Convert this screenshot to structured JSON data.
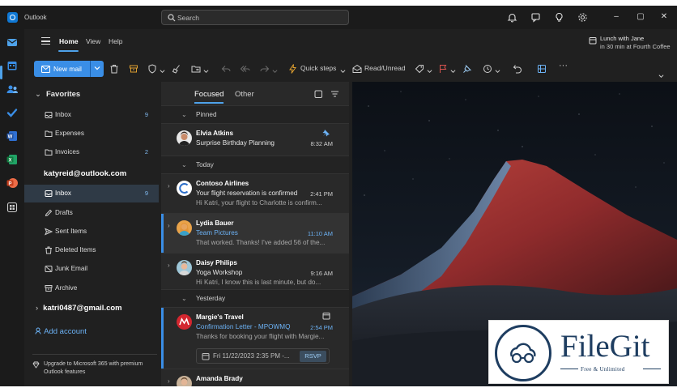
{
  "app": {
    "title": "Outlook"
  },
  "search": {
    "placeholder": "Search"
  },
  "ribbon": {
    "tabs": [
      "Home",
      "View",
      "Help"
    ],
    "reminder": {
      "title": "Lunch with Jane",
      "detail": "in 30 min at Fourth Coffee"
    }
  },
  "toolbar": {
    "new_mail": "New mail",
    "quick_steps": "Quick steps",
    "read_unread": "Read/Unread"
  },
  "folders": {
    "favorites_label": "Favorites",
    "favorites": [
      {
        "name": "Inbox",
        "count": "9"
      },
      {
        "name": "Expenses",
        "count": ""
      },
      {
        "name": "Invoices",
        "count": "2"
      }
    ],
    "account1": "katyreid@outlook.com",
    "account1_items": [
      {
        "name": "Inbox",
        "count": "9"
      },
      {
        "name": "Drafts",
        "count": ""
      },
      {
        "name": "Sent Items",
        "count": ""
      },
      {
        "name": "Deleted Items",
        "count": ""
      },
      {
        "name": "Junk Email",
        "count": ""
      },
      {
        "name": "Archive",
        "count": ""
      }
    ],
    "account2": "katri0487@gmail.com",
    "add_account": "Add account",
    "upgrade": "Upgrade to Microsoft 365 with premium Outlook features"
  },
  "message_list": {
    "tab_focused": "Focused",
    "tab_other": "Other",
    "groups": {
      "pinned": "Pinned",
      "today": "Today",
      "yesterday": "Yesterday"
    },
    "messages": [
      {
        "from": "Elvia Atkins",
        "subject": "Surprise Birthday Planning",
        "preview": "",
        "time": "8:32 AM"
      },
      {
        "from": "Contoso Airlines",
        "subject": "Your flight reservation is confirmed",
        "preview": "Hi Katri, your flight to Charlotte is confirm...",
        "time": "2:41 PM"
      },
      {
        "from": "Lydia Bauer",
        "subject": "Team Pictures",
        "preview": "That worked. Thanks! I've added 56 of the...",
        "time": "11:10 AM"
      },
      {
        "from": "Daisy Philips",
        "subject": "Yoga Workshop",
        "preview": "Hi Katri, I know this is last minute, but do...",
        "time": "9:16 AM"
      },
      {
        "from": "Margie's Travel",
        "subject": "Confirmation Letter - MPOWMQ",
        "preview": "Thanks for booking your flight with Margie...",
        "time": "2:54 PM",
        "event": "Fri 11/22/2023 2:35 PM -...",
        "rsvp": "RSVP"
      },
      {
        "from": "Amanda Brady",
        "subject": "",
        "preview": "",
        "time": ""
      }
    ]
  },
  "watermark": {
    "name": "FileGit",
    "tagline": "Free & Unlimited"
  },
  "colors": {
    "accent": "#3a8ee6",
    "link": "#6cb2f5",
    "background": "#202020",
    "list": "#292929"
  }
}
